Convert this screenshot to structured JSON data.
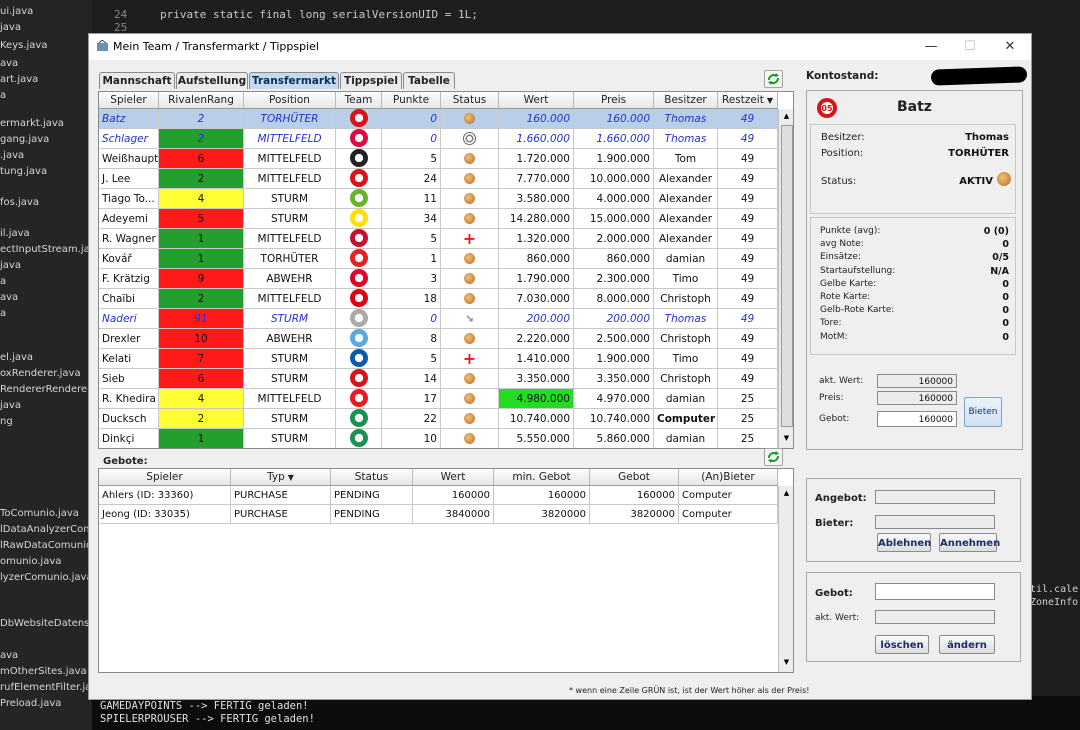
{
  "ide": {
    "files": [
      "ui.java",
      "java",
      "Keys.java",
      "ava",
      "art.java",
      "a",
      "ermarkt.java",
      "gang.java",
      ".java",
      "tung.java",
      "fos.java",
      "il.java",
      "ectInputStream.java",
      "java",
      "a",
      "ava",
      "a",
      "el.java",
      "oxRenderer.java",
      "RendererRenderer.java",
      "java",
      "ng",
      "ToComunio.java",
      "lDataAnalyzerComu",
      "lRawDataComunio.j",
      "omunio.java",
      "lyzerComunio.java",
      "DbWebsiteDatensa",
      "ava",
      "mOtherSites.java",
      "rufElementFilter.java",
      "Preload.java"
    ],
    "line_numbers": [
      "24",
      "25"
    ],
    "code_line": "private static final long serialVersionUID = 1L;",
    "console": [
      "GAMEDAYPOINTS --> FERTIG geladen!",
      "SPIELERPROUSER --> FERTIG geladen!"
    ],
    "right_code": [
      "til.cale",
      "ZoneInfo"
    ]
  },
  "window": {
    "title": "Mein Team / Transfermarkt / Tippspiel"
  },
  "tabs": [
    {
      "label": "Mannschaft",
      "active": false
    },
    {
      "label": "Aufstellung",
      "active": false
    },
    {
      "label": "Transfermarkt",
      "active": true
    },
    {
      "label": "Tippspiel",
      "active": false
    },
    {
      "label": "Tabelle",
      "active": false
    }
  ],
  "market": {
    "columns": [
      "Spieler",
      "RivalenRang",
      "Position",
      "Team",
      "Punkte",
      "Status",
      "Wert",
      "Preis",
      "Besitzer",
      "Restzeit"
    ],
    "sort_indicator": "▼",
    "rows": [
      {
        "spieler": "Batz",
        "rang": "2",
        "rang_color": "",
        "position": "TORHÜTER",
        "team_color": "#d7141a",
        "punkte": "0",
        "status": "ok",
        "wert": "160.000",
        "preis": "160.000",
        "besitzer": "Thomas",
        "restzeit": "49",
        "style": "selected",
        "wert_highlight": false,
        "bold_owner": false
      },
      {
        "spieler": "Schlager",
        "rang": "2",
        "rang_color": "#239f2d",
        "position": "MITTELFELD",
        "team_color": "#dd0741",
        "punkte": "0",
        "status": "ball",
        "wert": "1.660.000",
        "preis": "1.660.000",
        "besitzer": "Thomas",
        "restzeit": "49",
        "style": "italic",
        "wert_highlight": false,
        "bold_owner": false
      },
      {
        "spieler": "Weißhaupt",
        "rang": "6",
        "rang_color": "#ff1a1a",
        "position": "MITTELFELD",
        "team_color": "#222222",
        "punkte": "5",
        "status": "ok",
        "wert": "1.720.000",
        "preis": "1.900.000",
        "besitzer": "Tom",
        "restzeit": "49",
        "style": "",
        "wert_highlight": false,
        "bold_owner": false
      },
      {
        "spieler": "J. Lee",
        "rang": "2",
        "rang_color": "#239f2d",
        "position": "MITTELFELD",
        "team_color": "#d7141a",
        "punkte": "24",
        "status": "ok",
        "wert": "7.770.000",
        "preis": "10.000.000",
        "besitzer": "Alexander",
        "restzeit": "49",
        "style": "",
        "wert_highlight": false,
        "bold_owner": false
      },
      {
        "spieler": "Tiago To...",
        "rang": "4",
        "rang_color": "#ffff33",
        "position": "STURM",
        "team_color": "#65b32e",
        "punkte": "11",
        "status": "ok",
        "wert": "3.580.000",
        "preis": "4.000.000",
        "besitzer": "Alexander",
        "restzeit": "49",
        "style": "",
        "wert_highlight": false,
        "bold_owner": false
      },
      {
        "spieler": "Adeyemi",
        "rang": "5",
        "rang_color": "#ff1a1a",
        "position": "STURM",
        "team_color": "#fde100",
        "punkte": "34",
        "status": "ok",
        "wert": "14.280.000",
        "preis": "15.000.000",
        "besitzer": "Alexander",
        "restzeit": "49",
        "style": "",
        "wert_highlight": false,
        "bold_owner": false
      },
      {
        "spieler": "R. Wagner",
        "rang": "1",
        "rang_color": "#239f2d",
        "position": "MITTELFELD",
        "team_color": "#c8102e",
        "punkte": "5",
        "status": "cross",
        "wert": "1.320.000",
        "preis": "2.000.000",
        "besitzer": "Alexander",
        "restzeit": "49",
        "style": "",
        "wert_highlight": false,
        "bold_owner": false
      },
      {
        "spieler": "Kovář",
        "rang": "1",
        "rang_color": "#239f2d",
        "position": "TORHÜTER",
        "team_color": "#e32221",
        "punkte": "1",
        "status": "ok",
        "wert": "860.000",
        "preis": "860.000",
        "besitzer": "damian",
        "restzeit": "49",
        "style": "",
        "wert_highlight": false,
        "bold_owner": false
      },
      {
        "spieler": "F. Krätzig",
        "rang": "9",
        "rang_color": "#ff1a1a",
        "position": "ABWEHR",
        "team_color": "#dc052d",
        "punkte": "3",
        "status": "ok",
        "wert": "1.790.000",
        "preis": "2.300.000",
        "besitzer": "Timo",
        "restzeit": "49",
        "style": "",
        "wert_highlight": false,
        "bold_owner": false
      },
      {
        "spieler": "Chaïbi",
        "rang": "2",
        "rang_color": "#239f2d",
        "position": "MITTELFELD",
        "team_color": "#e1000f",
        "punkte": "18",
        "status": "ok",
        "wert": "7.030.000",
        "preis": "8.000.000",
        "besitzer": "Christoph",
        "restzeit": "49",
        "style": "",
        "wert_highlight": false,
        "bold_owner": false
      },
      {
        "spieler": "Naderi",
        "rang": "91",
        "rang_color": "#ff1a1a",
        "position": "STURM",
        "team_color": "#aaaaaa",
        "punkte": "0",
        "status": "boot",
        "wert": "200.000",
        "preis": "200.000",
        "besitzer": "Thomas",
        "restzeit": "49",
        "style": "italic",
        "wert_highlight": false,
        "bold_owner": false
      },
      {
        "spieler": "Drexler",
        "rang": "10",
        "rang_color": "#ff1a1a",
        "position": "ABWEHR",
        "team_color": "#5aa9e0",
        "punkte": "8",
        "status": "ok",
        "wert": "2.220.000",
        "preis": "2.500.000",
        "besitzer": "Christoph",
        "restzeit": "49",
        "style": "",
        "wert_highlight": false,
        "bold_owner": false
      },
      {
        "spieler": "Kelati",
        "rang": "7",
        "rang_color": "#ff1a1a",
        "position": "STURM",
        "team_color": "#0a5ba7",
        "punkte": "5",
        "status": "cross",
        "wert": "1.410.000",
        "preis": "1.900.000",
        "besitzer": "Timo",
        "restzeit": "49",
        "style": "",
        "wert_highlight": false,
        "bold_owner": false
      },
      {
        "spieler": "Sieb",
        "rang": "6",
        "rang_color": "#ff1a1a",
        "position": "STURM",
        "team_color": "#d7141a",
        "punkte": "14",
        "status": "ok",
        "wert": "3.350.000",
        "preis": "3.350.000",
        "besitzer": "Christoph",
        "restzeit": "49",
        "style": "",
        "wert_highlight": false,
        "bold_owner": false
      },
      {
        "spieler": "R. Khedira",
        "rang": "4",
        "rang_color": "#ffff33",
        "position": "MITTELFELD",
        "team_color": "#eb1923",
        "punkte": "17",
        "status": "ok",
        "wert": "4.980.000",
        "preis": "4.970.000",
        "besitzer": "damian",
        "restzeit": "25",
        "style": "",
        "wert_highlight": true,
        "bold_owner": false
      },
      {
        "spieler": "Ducksch",
        "rang": "2",
        "rang_color": "#ffff33",
        "position": "STURM",
        "team_color": "#1d9053",
        "punkte": "22",
        "status": "ok",
        "wert": "10.740.000",
        "preis": "10.740.000",
        "besitzer": "Computer",
        "restzeit": "25",
        "style": "",
        "wert_highlight": false,
        "bold_owner": true
      },
      {
        "spieler": "Dinkçi",
        "rang": "1",
        "rang_color": "#239f2d",
        "position": "STURM",
        "team_color": "#1d9053",
        "punkte": "10",
        "status": "ok",
        "wert": "5.550.000",
        "preis": "5.860.000",
        "besitzer": "damian",
        "restzeit": "25",
        "style": "",
        "wert_highlight": false,
        "bold_owner": false
      }
    ]
  },
  "offers": {
    "label": "Gebote:",
    "columns": [
      "Spieler",
      "Typ",
      "Status",
      "Wert",
      "min. Gebot",
      "Gebot",
      "(An)Bieter"
    ],
    "typ_sort": "▼",
    "rows": [
      {
        "spieler": "Ahlers (ID: 33360)",
        "typ": "PURCHASE",
        "status": "PENDING",
        "wert": "160000",
        "min": "160000",
        "gebot": "160000",
        "bieter": "Computer"
      },
      {
        "spieler": "Jeong (ID: 33035)",
        "typ": "PURCHASE",
        "status": "PENDING",
        "wert": "3840000",
        "min": "3820000",
        "gebot": "3820000",
        "bieter": "Computer"
      }
    ]
  },
  "footnote": "* wenn eine Zeile GRÜN ist, ist der Wert höher als der Preis!",
  "account": {
    "label": "Kontostand:"
  },
  "detail": {
    "name": "Batz",
    "club_color": "#d7141a",
    "besitzer_label": "Besitzer:",
    "besitzer": "Thomas",
    "position_label": "Position:",
    "position": "TORHÜTER",
    "status_label": "Status:",
    "status": "AKTIV",
    "stats": [
      {
        "label": "Punkte (avg):",
        "value": "0 (0)"
      },
      {
        "label": "avg Note:",
        "value": "0"
      },
      {
        "label": "Einsätze:",
        "value": "0/5"
      },
      {
        "label": "Startaufstellung:",
        "value": "N/A"
      },
      {
        "label": "Gelbe Karte:",
        "value": "0"
      },
      {
        "label": "Rote Karte:",
        "value": "0"
      },
      {
        "label": "Gelb-Rote Karte:",
        "value": "0"
      },
      {
        "label": "Tore:",
        "value": "0"
      },
      {
        "label": "MotM:",
        "value": "0"
      }
    ],
    "akt_wert_label": "akt. Wert:",
    "akt_wert": "160000",
    "preis_label": "Preis:",
    "preis": "160000",
    "gebot_label": "Gebot:",
    "gebot": "160000",
    "bieten_label": "Bieten"
  },
  "offer_box": {
    "angebot_label": "Angebot:",
    "bieter_label": "Bieter:",
    "ablehnen_label": "Ablehnen",
    "annehmen_label": "Annehmen"
  },
  "bid_box": {
    "gebot_label": "Gebot:",
    "akt_wert_label": "akt. Wert:",
    "loeschen_label": "löschen",
    "aendern_label": "ändern"
  }
}
